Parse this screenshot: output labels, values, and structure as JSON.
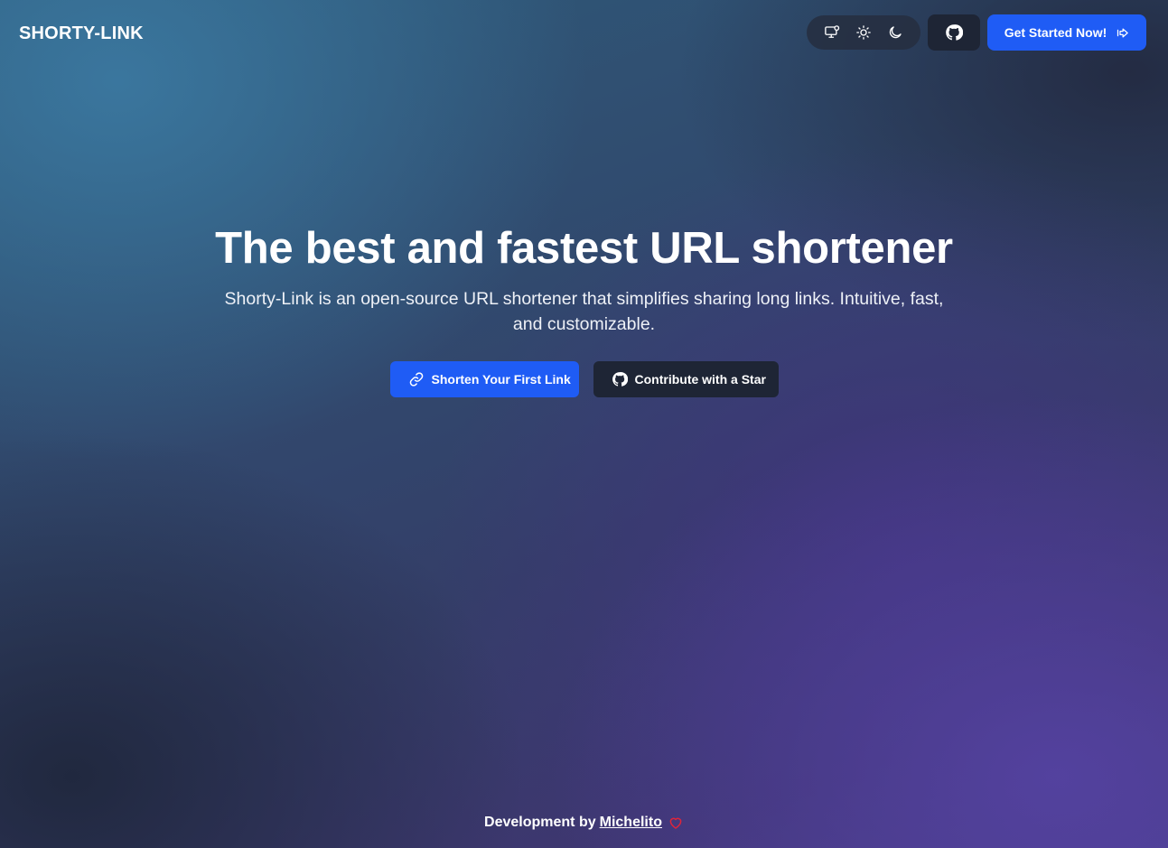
{
  "header": {
    "brand": "SHORTY-LINK",
    "theme_options": [
      {
        "icon": "monitor-icon",
        "label": "System"
      },
      {
        "icon": "sun-icon",
        "label": "Light"
      },
      {
        "icon": "moon-icon",
        "label": "Dark"
      }
    ],
    "github_icon": "github-icon",
    "cta_label": "Get Started Now!",
    "cta_icon": "arrow-right-icon"
  },
  "hero": {
    "title": "The best and fastest URL shortener",
    "subtitle": "Shorty-Link is an open-source URL shortener that simplifies sharing long links. Intuitive, fast, and customizable.",
    "primary_label": "Shorten Your First Link",
    "primary_icon": "link-icon",
    "secondary_label": "Contribute with a Star",
    "secondary_icon": "github-icon"
  },
  "footer": {
    "prefix": "Development by",
    "author": "Michelito",
    "icon": "heart-icon"
  },
  "colors": {
    "accent": "#1f5cf5",
    "dark_button": "#1e2535",
    "heart": "#e0243a"
  }
}
